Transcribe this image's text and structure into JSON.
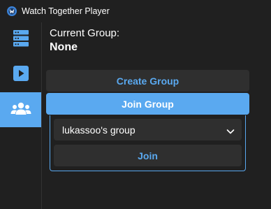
{
  "window": {
    "title": "Watch Together Player",
    "icon": "app-logo-icon"
  },
  "colors": {
    "background": "#202020",
    "accent": "#5aa9f0",
    "button": "#2f2f2f",
    "text": "#ffffff"
  },
  "sidebar": {
    "items": [
      {
        "name": "servers",
        "icon": "server-list-icon",
        "active": false
      },
      {
        "name": "player",
        "icon": "play-icon",
        "active": false
      },
      {
        "name": "groups",
        "icon": "group-users-icon",
        "active": true
      }
    ]
  },
  "main": {
    "current_group_label": "Current Group:",
    "current_group_value": "None",
    "create_group_label": "Create Group",
    "join_group_label": "Join Group",
    "group_select_value": "lukassoo's group",
    "join_label": "Join"
  }
}
